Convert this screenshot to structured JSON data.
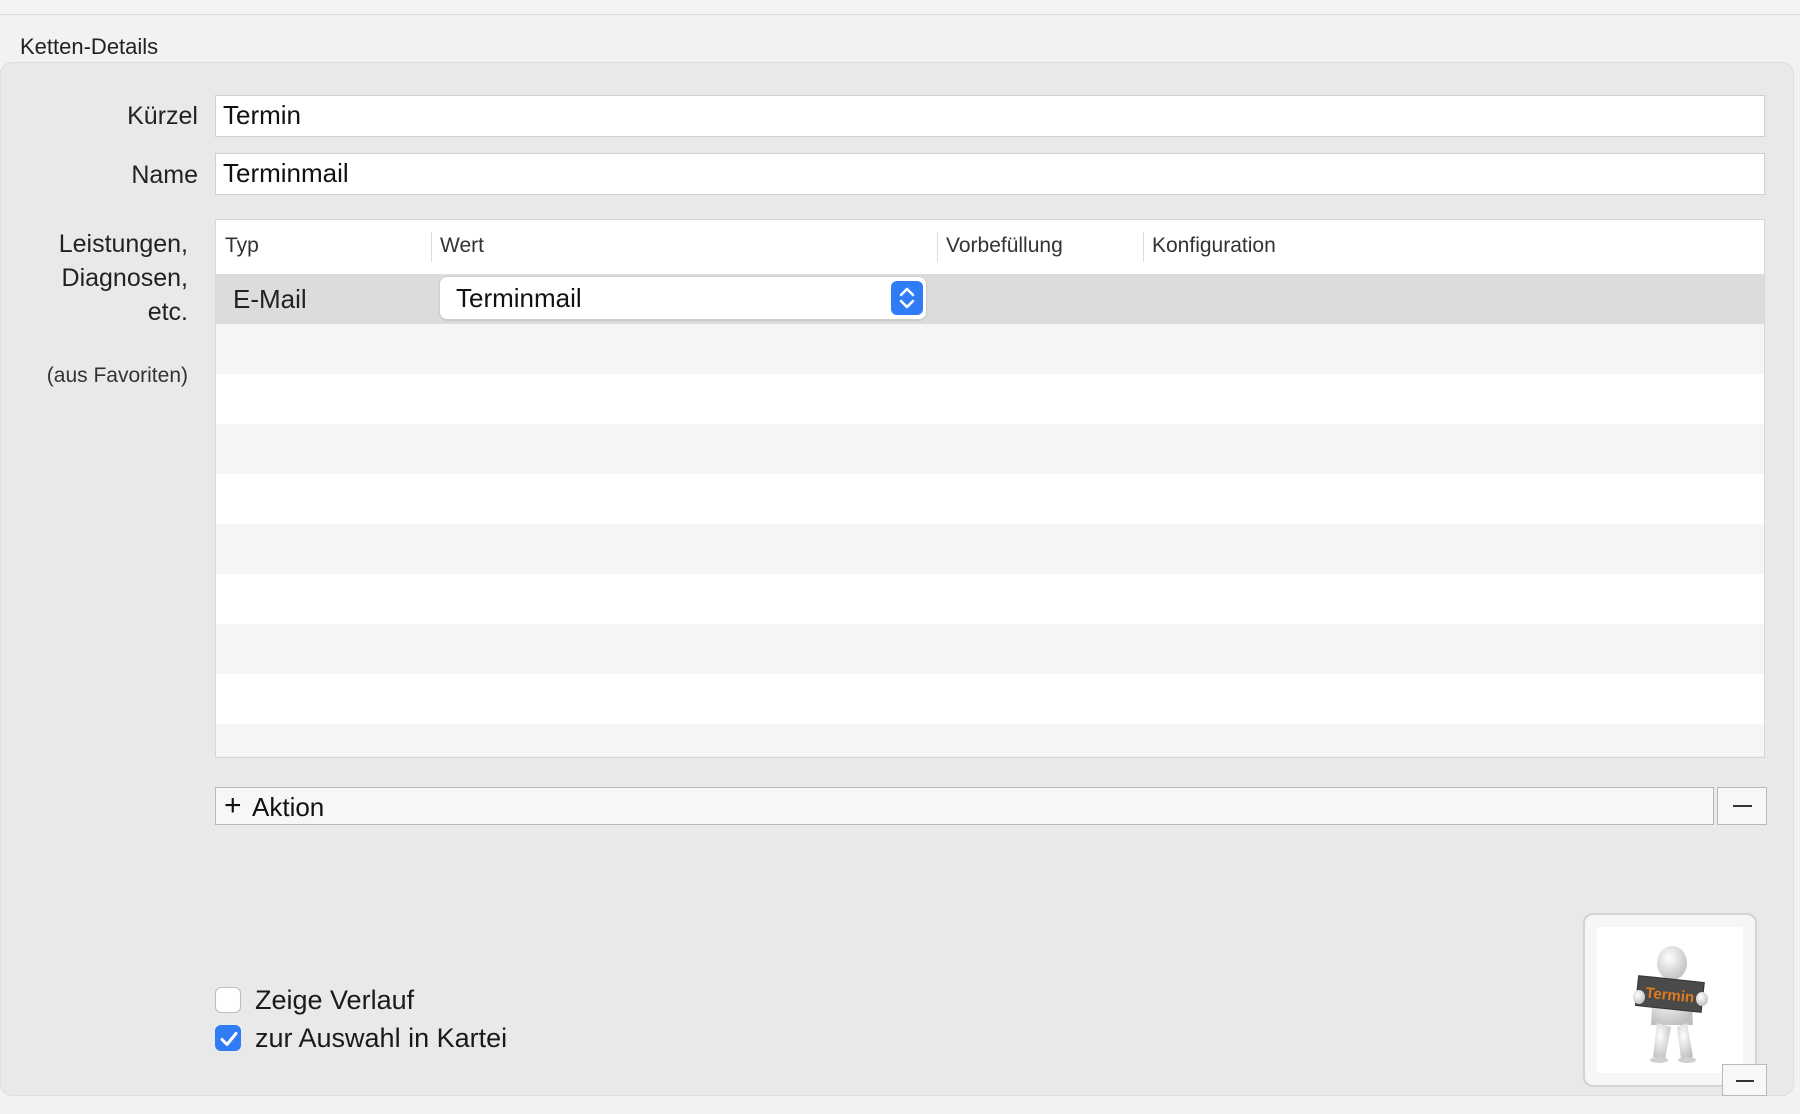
{
  "group_title": "Ketten-Details",
  "form": {
    "kuerzel_label": "Kürzel",
    "kuerzel_value": "Termin",
    "name_label": "Name",
    "name_value": "Terminmail",
    "list_label_line1": "Leistungen,",
    "list_label_line2": "Diagnosen,",
    "list_label_line3": "etc.",
    "list_sublabel": "(aus Favoriten)"
  },
  "table": {
    "columns": [
      "Typ",
      "Wert",
      "Vorbefüllung",
      "Konfiguration"
    ],
    "rows": [
      {
        "typ": "E-Mail",
        "wert": "Terminmail",
        "vorbefuellung": "",
        "konfiguration": ""
      }
    ]
  },
  "actions": {
    "add_label": "Aktion",
    "remove_icon": "minus-icon"
  },
  "options": {
    "zeige_verlauf_label": "Zeige Verlauf",
    "zeige_verlauf_checked": false,
    "zur_auswahl_label": "zur Auswahl in Kartei",
    "zur_auswahl_checked": true
  },
  "image": {
    "sign_text": "Termin"
  },
  "colors": {
    "accent": "#2f7cf6",
    "sign_text": "#e07a1f"
  }
}
